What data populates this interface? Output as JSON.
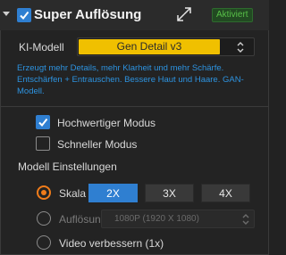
{
  "header": {
    "title": "Super Auflösung",
    "badge": "Aktiviert",
    "enabled": true
  },
  "model": {
    "label": "KI-Modell",
    "selected": "Gen Detail v3"
  },
  "description": "Erzeugt mehr Details, mehr Klarheit und mehr Schärfe. Entschärfen + Entrauschen. Bessere Haut und Haare. GAN-Modell.",
  "options": {
    "high_quality": {
      "label": "Hochwertiger Modus",
      "checked": true
    },
    "fast_mode": {
      "label": "Schneller Modus",
      "checked": false
    }
  },
  "settings": {
    "heading": "Modell Einstellungen",
    "scale": {
      "label": "Skala",
      "selected": true,
      "buttons": [
        "2X",
        "3X",
        "4X"
      ],
      "active_index": 0
    },
    "resolution": {
      "label": "Auflösung",
      "selected": false,
      "value": "1080P (1920 X 1080)"
    },
    "enhance": {
      "label": "Video verbessern (1x)",
      "selected": false
    }
  },
  "colors": {
    "accent_blue": "#2f7fd1",
    "accent_orange": "#f07c1a",
    "accent_yellow": "#f0c000",
    "link_blue": "#2d93e0",
    "badge_green": "#58c048"
  }
}
